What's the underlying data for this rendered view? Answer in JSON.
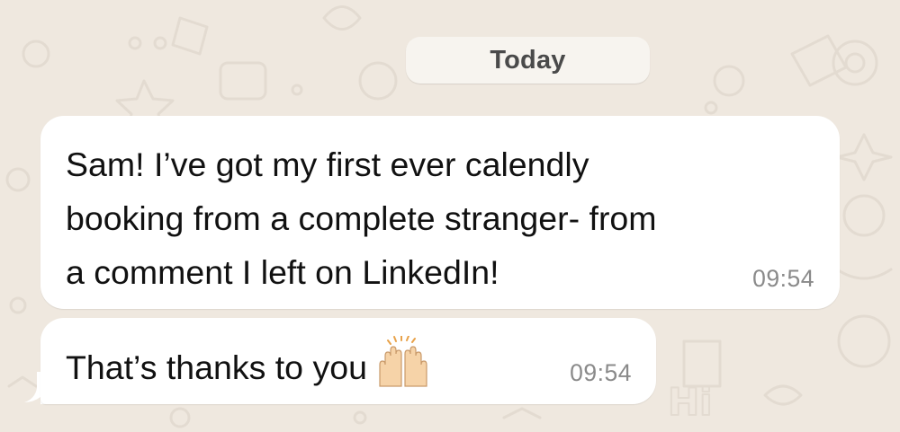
{
  "chat": {
    "date_separator": "Today",
    "messages": [
      {
        "text": "Sam! I’ve got my first ever calendly\nbooking from a complete stranger- from\na comment I left on LinkedIn!",
        "time": "09:54"
      },
      {
        "text": "That’s thanks to you",
        "emoji": "raising-hands-icon",
        "time": "09:54"
      }
    ]
  },
  "colors": {
    "wallpaper": "#efe8df",
    "bubble": "#ffffff",
    "date_pill": "#f7f4ef",
    "timestamp": "#8a8a8a",
    "text": "#111111"
  }
}
